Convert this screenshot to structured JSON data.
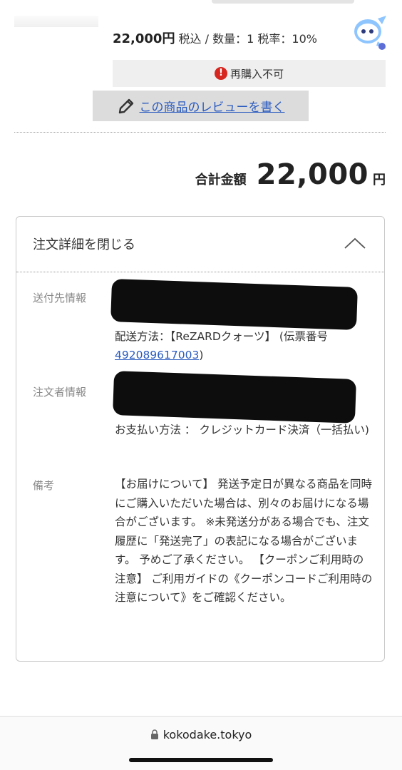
{
  "product": {
    "price": "22,000円",
    "tax_info": " 税込 / 数量：1 税率：10%",
    "no_rebuy_label": "再購入不可",
    "review_link_label": "この商品のレビューを書く"
  },
  "total": {
    "label": "合計金額",
    "amount": "22,000",
    "currency": "円"
  },
  "details": {
    "toggle_label": "注文詳細を閉じる",
    "shipping_label": "送付先情報",
    "shipping_method_label": "配送方法：【ReZARDクォーツ】 (伝票番号",
    "tracking_number": "492089617003",
    "tracking_suffix": ")",
    "orderer_label": "注文者情報",
    "payment_method": "お支払い方法 ： クレジットカード決済（一括払い)",
    "notes_label": "備考",
    "notes_text": "【お届けについて】 発送予定日が異なる商品を同時にご購入いただいた場合は、別々のお届けになる場合がございます。 ※未発送分がある場合でも、注文履歴に「発送完了」の表記になる場合がございます。 予めご了承ください。 【クーポンご利用時の注意】 ご利用ガイドの《クーポンコードご利用時の注意について》をご確認ください。"
  },
  "browser": {
    "url": "kokodake.tokyo"
  },
  "colors": {
    "link": "#2b5bbf",
    "alert": "#d6261f",
    "mascot": "#8ec5ff"
  },
  "icons": [
    "alert-icon",
    "pencil-icon",
    "chevron-up-icon",
    "lock-icon",
    "mascot-icon"
  ]
}
